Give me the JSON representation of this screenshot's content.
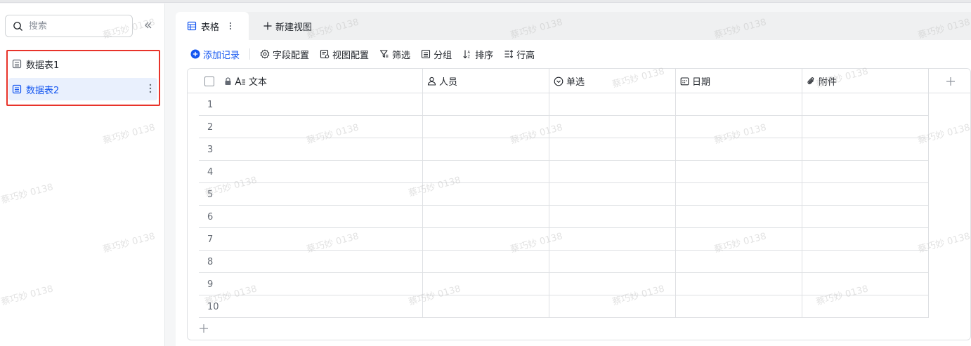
{
  "sidebar": {
    "search_placeholder": "搜索",
    "tables": [
      {
        "label": "数据表1",
        "selected": false
      },
      {
        "label": "数据表2",
        "selected": true
      }
    ]
  },
  "tabs": {
    "active_label": "表格",
    "new_view_label": "新建视图"
  },
  "toolbar": {
    "add_record": "添加记录",
    "field_config": "字段配置",
    "view_config": "视图配置",
    "filter": "筛选",
    "group": "分组",
    "sort": "排序",
    "row_height": "行高"
  },
  "grid": {
    "columns": [
      {
        "label": "文本",
        "icon": "text-icon",
        "locked": true
      },
      {
        "label": "人员",
        "icon": "person-icon"
      },
      {
        "label": "单选",
        "icon": "single-select-icon"
      },
      {
        "label": "日期",
        "icon": "calendar-icon"
      },
      {
        "label": "附件",
        "icon": "attachment-icon"
      }
    ],
    "row_numbers": [
      "1",
      "2",
      "3",
      "4",
      "5",
      "6",
      "7",
      "8",
      "9",
      "10"
    ]
  },
  "watermark": "蔡巧妙 0138",
  "colors": {
    "accent": "#1456f0",
    "selected_bg": "#e9f0fd",
    "highlight_border": "#e8332a"
  }
}
